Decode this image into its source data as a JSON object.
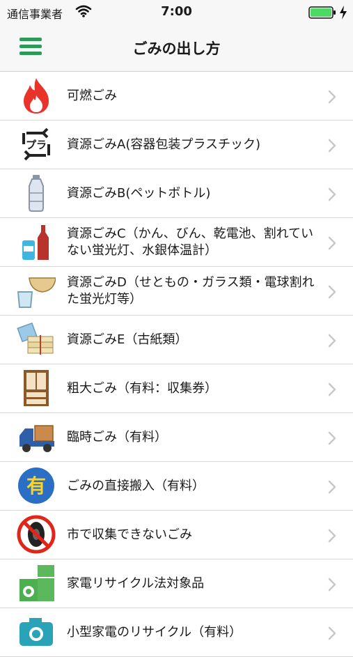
{
  "status_bar": {
    "carrier": "通信事業者",
    "time": "7:00"
  },
  "nav": {
    "title": "ごみの出し方"
  },
  "items": [
    {
      "label": "可燃ごみ",
      "icon": "fire-icon"
    },
    {
      "label": "資源ごみA(容器包装プラスチック)",
      "icon": "plastic-recycle-icon"
    },
    {
      "label": "資源ごみB(ペットボトル)",
      "icon": "pet-bottle-icon"
    },
    {
      "label": "資源ごみC（かん、びん、乾電池、割れていない蛍光灯、水銀体温計）",
      "icon": "can-bottle-icon"
    },
    {
      "label": "資源ごみD（せともの・ガラス類・電球割れた蛍光灯等）",
      "icon": "bowl-glass-icon"
    },
    {
      "label": "資源ごみE（古紙類）",
      "icon": "paper-bundle-icon"
    },
    {
      "label": "粗大ごみ（有料：収集券）",
      "icon": "cabinet-icon"
    },
    {
      "label": "臨時ごみ（有料）",
      "icon": "truck-icon"
    },
    {
      "label": "ごみの直接搬入（有料）",
      "icon": "paid-badge-icon"
    },
    {
      "label": "市で収集できないごみ",
      "icon": "no-tire-icon"
    },
    {
      "label": "家電リサイクル法対象品",
      "icon": "appliance-icon"
    },
    {
      "label": "小型家電のリサイクル（有料）",
      "icon": "camera-icon"
    }
  ],
  "icon_text": {
    "paid": "有"
  },
  "colors": {
    "accent_green": "#2e9a5a",
    "battery_green": "#4cd964",
    "fire_red": "#e8322a"
  }
}
